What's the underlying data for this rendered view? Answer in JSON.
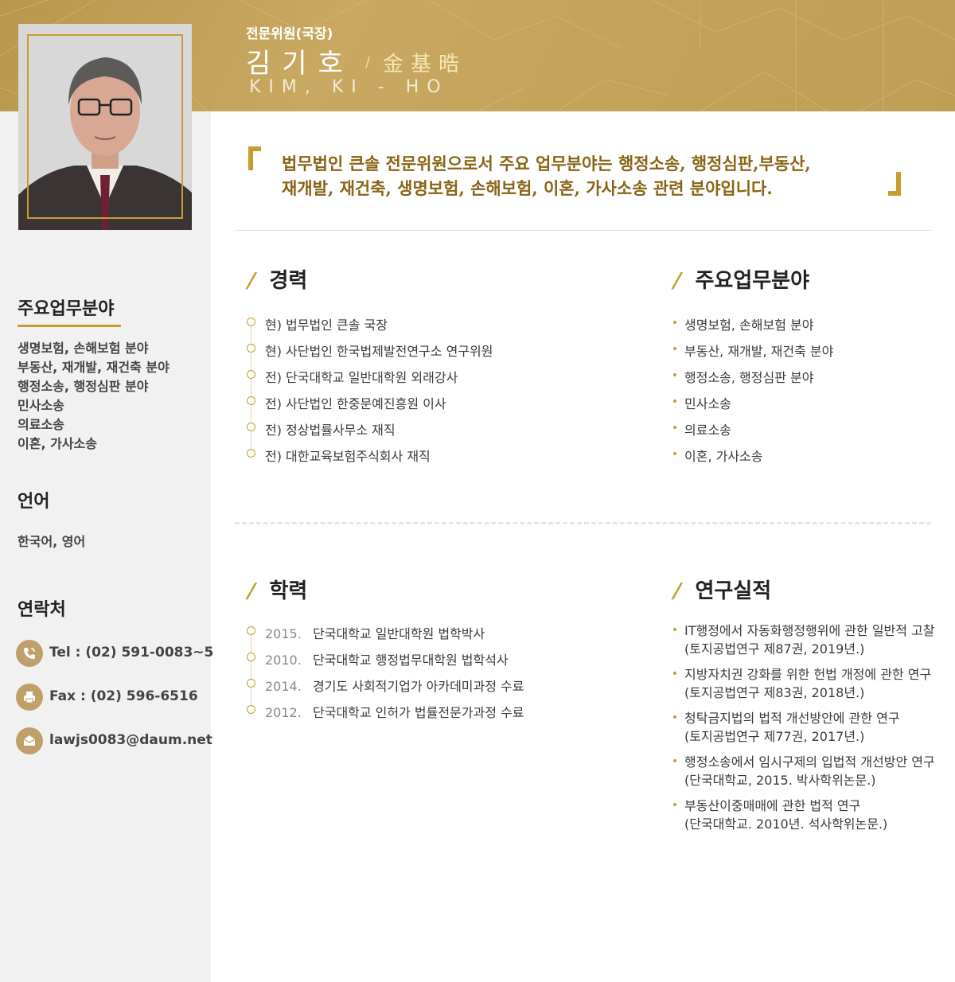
{
  "header": {
    "role": "전문위원(국장)",
    "name_korean": "김기호",
    "slash": "/",
    "name_hanja": "金基晧",
    "name_roman": "KIM, KI - HO"
  },
  "quote": {
    "line1": "법무법인 큰솔 전문위원으로서 주요 업무분야는 행정소송, 행정심판,부동산,",
    "line2": "재개발, 재건축, 생명보험, 손해보험, 이혼, 가사소송 관련 분야입니다."
  },
  "sidebar": {
    "practice_title": "주요업무분야",
    "practice_items": [
      "생명보험, 손해보험 분야",
      "부동산, 재개발, 재건축 분야",
      "행정소송, 행정심판 분야",
      "민사소송",
      "의료소송",
      "이혼, 가사소송"
    ],
    "language_title": "언어",
    "language_value": "한국어, 영어",
    "contact_title": "연락처",
    "contacts": [
      {
        "icon": "phone-icon",
        "text": "Tel : (02) 591-0083~5"
      },
      {
        "icon": "fax-icon",
        "text": "Fax : (02) 596-6516"
      },
      {
        "icon": "email-icon",
        "text": "lawjs0083@daum.net"
      }
    ]
  },
  "career": {
    "title": "경력",
    "items": [
      "현) 법무법인 큰솔 국장",
      "현) 사단법인 한국법제발전연구소 연구위원",
      "전) 단국대학교 일반대학원 외래강사",
      "전) 사단법인 한중문예진흥원 이사",
      "전) 정상법률사무소 재직",
      "전) 대한교육보험주식회사 재직"
    ]
  },
  "practice": {
    "title": "주요업무분야",
    "items": [
      "생명보험, 손해보험 분야",
      "부동산, 재개발, 재건축 분야",
      "행정소송, 행정심판 분야",
      "민사소송",
      "의료소송",
      "이혼, 가사소송"
    ]
  },
  "education": {
    "title": "학력",
    "items": [
      {
        "year": "2015.",
        "text": "단국대학교 일반대학원 법학박사"
      },
      {
        "year": "2010.",
        "text": "단국대학교 행정법무대학원 법학석사"
      },
      {
        "year": "2014.",
        "text": "경기도 사회적기업가 아카데미과정 수료"
      },
      {
        "year": "2012.",
        "text": "단국대학교 인허가 법률전문가과정 수료"
      }
    ]
  },
  "research": {
    "title": "연구실적",
    "items": [
      {
        "title": "IT행정에서 자동화행정행위에 관한 일반적 고찰",
        "source": "(토지공법연구 제87권, 2019년.)"
      },
      {
        "title": "지방자치권 강화를 위한 헌법 개정에 관한 연구",
        "source": "(토지공법연구 제83권, 2018년.)"
      },
      {
        "title": "청탁금지법의 법적 개선방안에 관한 연구",
        "source": "(토지공법연구 제77권, 2017년.)"
      },
      {
        "title": "행정소송에서 임시구제의 입법적 개선방안 연구",
        "source": "(단국대학교, 2015. 박사학위논문.)"
      },
      {
        "title": "부동산이중매매에 관한 법적 연구",
        "source": "(단국대학교. 2010년. 석사학위논문.)"
      }
    ]
  },
  "colors": {
    "accent": "#c99c2e",
    "header_gold": "#c4a45a",
    "quote_text": "#8a6414",
    "sidebar_bg": "#f1f1f1"
  }
}
